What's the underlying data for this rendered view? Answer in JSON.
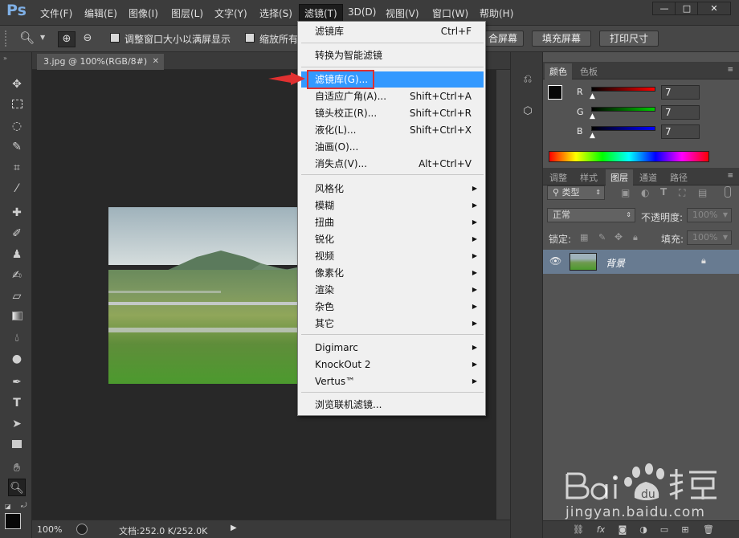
{
  "app": {
    "logo": "Ps"
  },
  "menubar": {
    "items": [
      "文件(F)",
      "编辑(E)",
      "图像(I)",
      "图层(L)",
      "文字(Y)",
      "选择(S)",
      "滤镜(T)",
      "3D(D)",
      "视图(V)",
      "窗口(W)",
      "帮助(H)"
    ],
    "window_controls": [
      "—",
      "□",
      "✕"
    ]
  },
  "options_bar": {
    "resize_window_label": "调整窗口大小以满屏显示",
    "zoom_all_label": "缩放所有",
    "fit_screen_button": "合屏幕",
    "fill_screen_button": "填充屏幕",
    "print_size_button": "打印尺寸"
  },
  "document": {
    "tab_title": "3.jpg @ 100%(RGB/8#)",
    "tab_close": "✕"
  },
  "status_bar": {
    "zoom": "100%",
    "doc_info": "文档:252.0 K/252.0K"
  },
  "filter_menu": {
    "items": [
      {
        "label": "滤镜库",
        "shortcut": "Ctrl+F"
      },
      {
        "label": "转换为智能滤镜",
        "shortcut": ""
      },
      {
        "label": "滤镜库(G)...",
        "shortcut": ""
      },
      {
        "label": "自适应广角(A)...",
        "shortcut": "Shift+Ctrl+A"
      },
      {
        "label": "镜头校正(R)...",
        "shortcut": "Shift+Ctrl+R"
      },
      {
        "label": "液化(L)...",
        "shortcut": "Shift+Ctrl+X"
      },
      {
        "label": "油画(O)...",
        "shortcut": ""
      },
      {
        "label": "消失点(V)...",
        "shortcut": "Alt+Ctrl+V"
      },
      {
        "label": "风格化",
        "shortcut": ""
      },
      {
        "label": "模糊",
        "shortcut": ""
      },
      {
        "label": "扭曲",
        "shortcut": ""
      },
      {
        "label": "锐化",
        "shortcut": ""
      },
      {
        "label": "视频",
        "shortcut": ""
      },
      {
        "label": "像素化",
        "shortcut": ""
      },
      {
        "label": "渲染",
        "shortcut": ""
      },
      {
        "label": "杂色",
        "shortcut": ""
      },
      {
        "label": "其它",
        "shortcut": ""
      },
      {
        "label": "Digimarc",
        "shortcut": ""
      },
      {
        "label": "KnockOut 2",
        "shortcut": ""
      },
      {
        "label": "Vertus™",
        "shortcut": ""
      },
      {
        "label": "浏览联机滤镜...",
        "shortcut": ""
      }
    ],
    "highlighted_index": 2
  },
  "color_panel": {
    "tabs": [
      "颜色",
      "色板"
    ],
    "channels": [
      {
        "name": "R",
        "value": "7",
        "color": "#ff0000"
      },
      {
        "name": "G",
        "value": "7",
        "color": "#00cc00"
      },
      {
        "name": "B",
        "value": "7",
        "color": "#0000ff"
      }
    ]
  },
  "layers_panel": {
    "tabs": [
      "调整",
      "样式",
      "图层",
      "通道",
      "路径"
    ],
    "filter_kind": "类型",
    "blend_mode": "正常",
    "opacity_label": "不透明度:",
    "opacity_value": "100%",
    "lock_label": "锁定:",
    "fill_label": "填充:",
    "fill_value": "100%",
    "layers": [
      {
        "name": "背景"
      }
    ]
  },
  "watermark": {
    "url": "jingyan.baidu.com"
  },
  "colors": {
    "menu_highlight": "#3399ff",
    "annotation_red": "#e03030"
  }
}
